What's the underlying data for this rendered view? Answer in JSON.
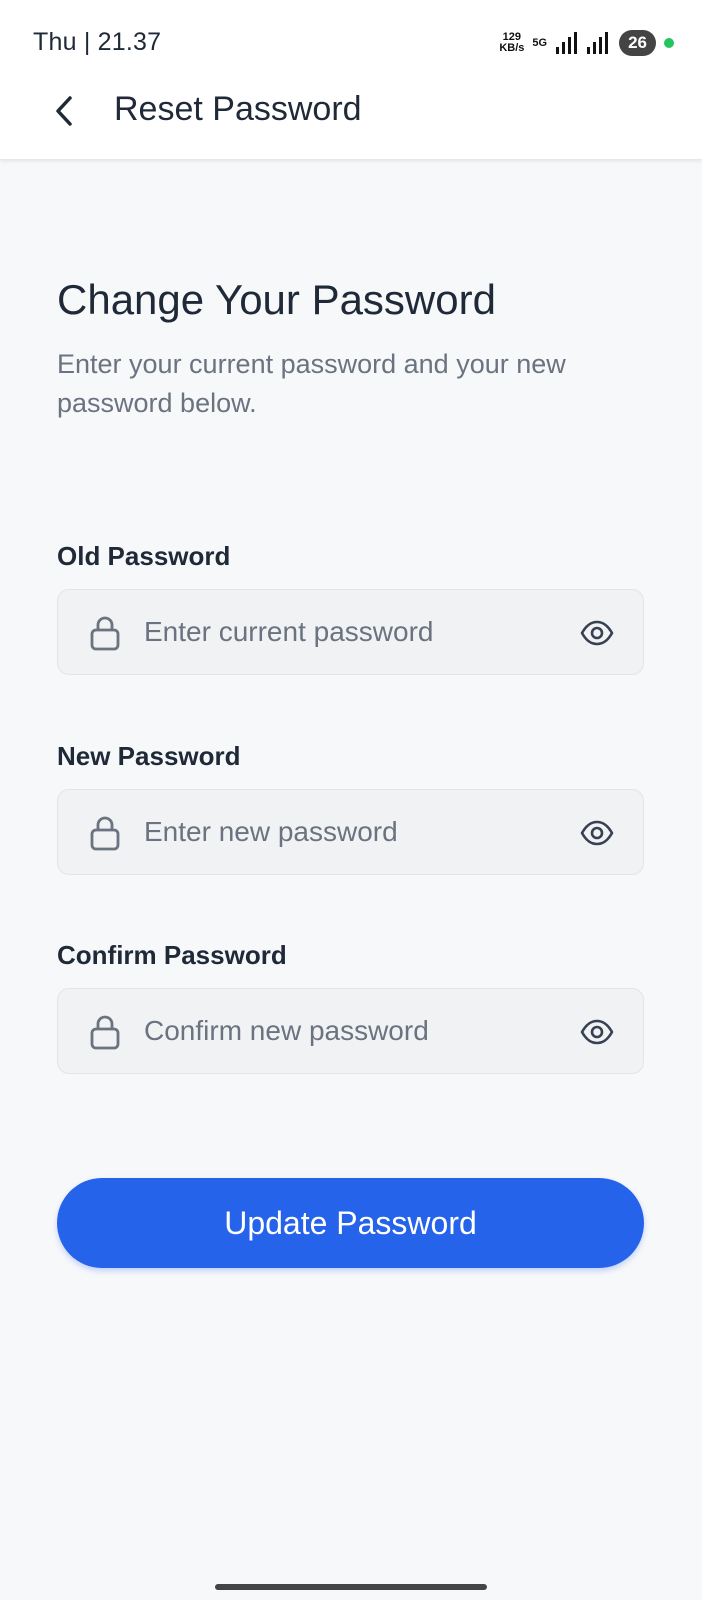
{
  "status_bar": {
    "time": "Thu | 21.37",
    "net_speed_value": "129",
    "net_speed_unit": "KB/s",
    "net_type": "5G",
    "battery": "26",
    "accent_dot_color": "#22c55e"
  },
  "app_bar": {
    "title": "Reset Password",
    "back_icon": "chevron-left-icon"
  },
  "main": {
    "heading": "Change Your Password",
    "subtext": "Enter your current password and your new password below.",
    "fields": [
      {
        "label": "Old Password",
        "placeholder": "Enter current password",
        "value": "",
        "leading_icon": "lock-icon",
        "trailing_icon": "eye-icon"
      },
      {
        "label": "New Password",
        "placeholder": "Enter new password",
        "value": "",
        "leading_icon": "lock-icon",
        "trailing_icon": "eye-icon"
      },
      {
        "label": "Confirm Password",
        "placeholder": "Confirm new password",
        "value": "",
        "leading_icon": "lock-icon",
        "trailing_icon": "eye-icon"
      }
    ],
    "submit_label": "Update Password"
  },
  "colors": {
    "primary": "#2563eb",
    "background": "#f7f8fa",
    "field_background": "#f1f2f4"
  }
}
